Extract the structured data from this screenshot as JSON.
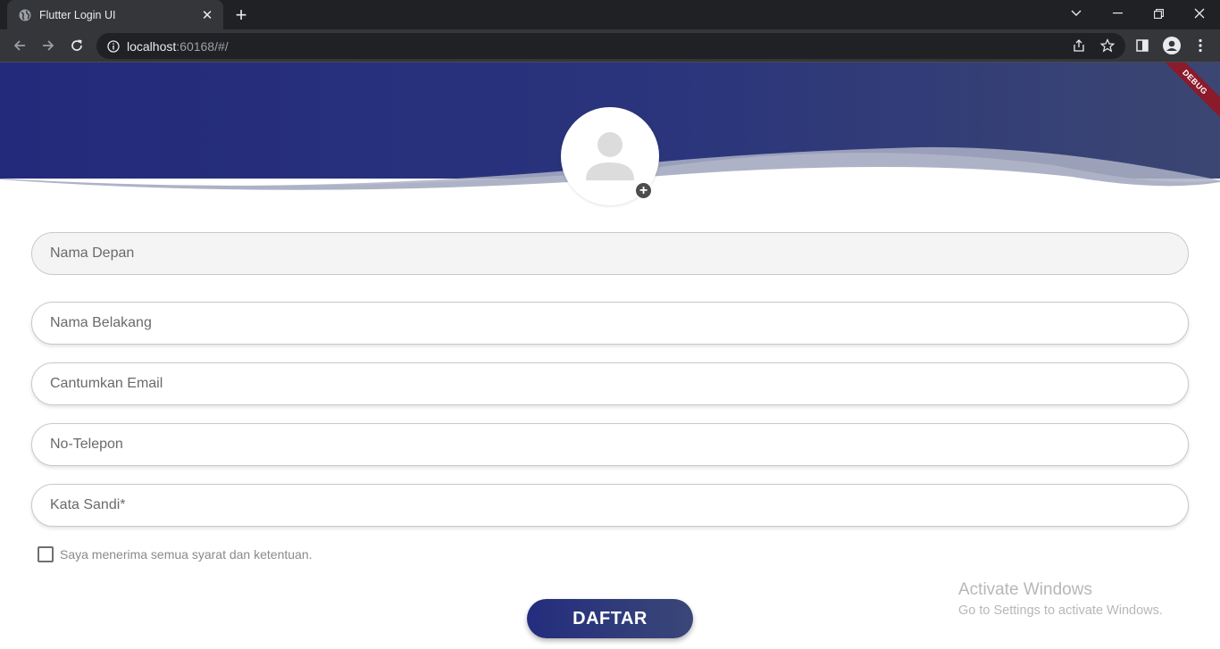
{
  "browser": {
    "tab_title": "Flutter Login UI",
    "url_host": "localhost",
    "url_rest": ":60168/#/"
  },
  "app": {
    "debug_banner": "DEBUG",
    "header_colors": {
      "start": "#232a7b",
      "end": "#3c4672",
      "wave": "#adb2c6"
    }
  },
  "form": {
    "first_name_placeholder": "Nama Depan",
    "last_name_placeholder": "Nama Belakang",
    "email_placeholder": "Cantumkan Email",
    "phone_placeholder": "No-Telepon",
    "password_placeholder": "Kata Sandi*",
    "terms_label": "Saya menerima semua syarat dan ketentuan.",
    "terms_checked": false,
    "submit_label": "DAFTAR"
  },
  "watermark": {
    "line1": "Activate Windows",
    "line2": "Go to Settings to activate Windows."
  }
}
